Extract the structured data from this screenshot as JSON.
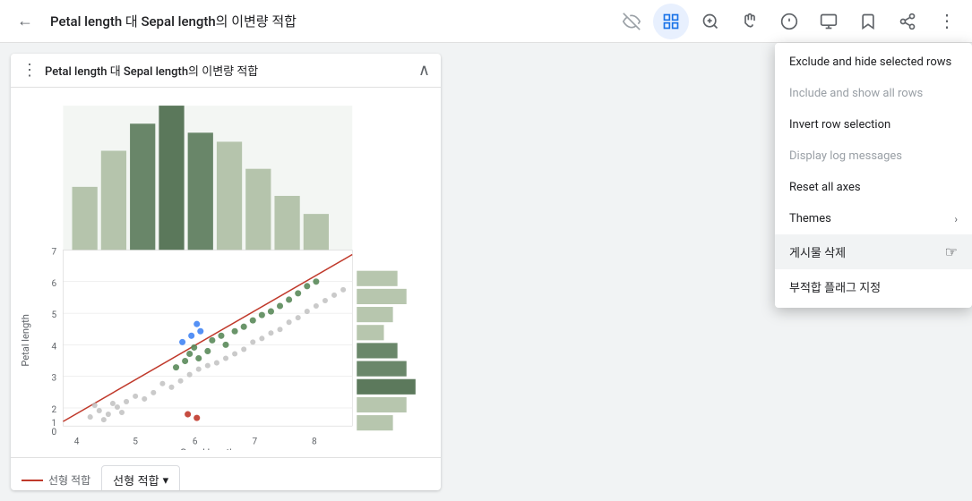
{
  "toolbar": {
    "back_icon": "←",
    "title": "Petal length 대 Sepal length의 이변량 적합",
    "icons": [
      {
        "name": "hide-icon",
        "symbol": "👁",
        "active": false
      },
      {
        "name": "select-icon",
        "symbol": "▦",
        "active": true
      },
      {
        "name": "zoom-icon",
        "symbol": "🔍",
        "active": false
      },
      {
        "name": "pan-icon",
        "symbol": "✋",
        "active": false
      },
      {
        "name": "info-icon",
        "symbol": "ℹ",
        "active": false
      },
      {
        "name": "present-icon",
        "symbol": "▭",
        "active": false
      },
      {
        "name": "bookmark-icon",
        "symbol": "🔖",
        "active": false
      },
      {
        "name": "share-icon",
        "symbol": "⤴",
        "active": false
      },
      {
        "name": "more-icon",
        "symbol": "⋮",
        "active": false
      }
    ]
  },
  "panel": {
    "title": "Petal length 대 Sepal length의 이변량 적합",
    "dots_icon": "⋮",
    "collapse_icon": "∧"
  },
  "legend": {
    "line_label": "선형 적합",
    "dropdown_label": "선형 적합",
    "dropdown_icon": "▾"
  },
  "context_menu": {
    "items": [
      {
        "label": "Exclude and hide selected rows",
        "disabled": false,
        "has_arrow": false
      },
      {
        "label": "Include and show all rows",
        "disabled": true,
        "has_arrow": false
      },
      {
        "label": "Invert row selection",
        "disabled": false,
        "has_arrow": false
      },
      {
        "label": "Display log messages",
        "disabled": true,
        "has_arrow": false
      },
      {
        "label": "Reset all axes",
        "disabled": false,
        "has_arrow": false
      },
      {
        "label": "Themes",
        "disabled": false,
        "has_arrow": true
      },
      {
        "label": "게시물 삭제",
        "disabled": false,
        "has_arrow": false,
        "highlighted": true
      },
      {
        "label": "부적합 플래그 지정",
        "disabled": false,
        "has_arrow": false
      }
    ]
  },
  "chart": {
    "x_label": "Sepal length",
    "y_label": "Petal length"
  }
}
